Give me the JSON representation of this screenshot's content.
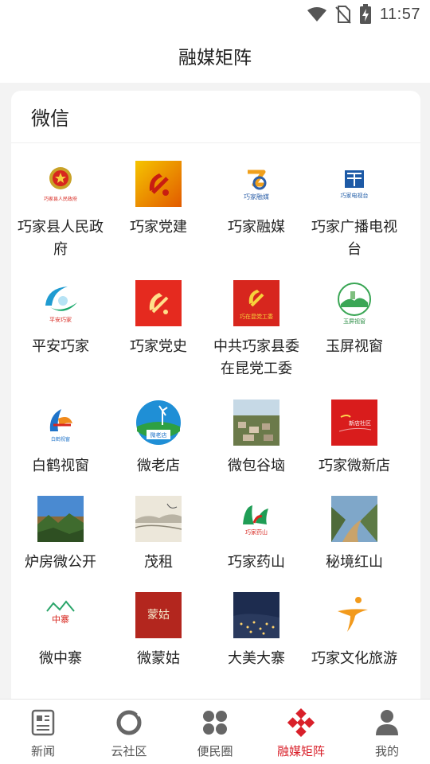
{
  "status_bar": {
    "time": "11:57"
  },
  "header": {
    "title": "融媒矩阵"
  },
  "section": {
    "title": "微信"
  },
  "accounts": [
    {
      "name": "巧家县人民政府",
      "logo_text": "巧家县人民政府",
      "logo": "emblem"
    },
    {
      "name": "巧家党建",
      "logo": "party-emblem"
    },
    {
      "name": "巧家融媒",
      "logo_text": "巧家融媒",
      "logo": "media"
    },
    {
      "name": "巧家广播电视台",
      "logo_text": "巧家电视台",
      "logo": "tv"
    },
    {
      "name": "平安巧家",
      "logo_text": "平安巧家",
      "logo": "swoosh"
    },
    {
      "name": "巧家党史",
      "logo": "party-history"
    },
    {
      "name": "中共巧家县委在昆党工委",
      "logo_text": "巧在昆党工委",
      "logo": "party-red"
    },
    {
      "name": "玉屏视窗",
      "logo_text": "玉屏视窗",
      "logo": "circle-landscape"
    },
    {
      "name": "白鹤视窗",
      "logo_text": "白鹤视窗",
      "logo": "crane"
    },
    {
      "name": "微老店",
      "logo_text": "微老店",
      "logo": "windmill"
    },
    {
      "name": "微包谷垴",
      "logo": "village-photo"
    },
    {
      "name": "巧家微新店",
      "logo_text": "新店社区",
      "logo": "red-flag"
    },
    {
      "name": "炉房微公开",
      "logo": "mountain-photo"
    },
    {
      "name": "茂租",
      "logo": "ink-photo"
    },
    {
      "name": "巧家药山",
      "logo_text": "巧家药山",
      "logo": "green-mark"
    },
    {
      "name": "秘境红山",
      "logo": "valley-photo"
    },
    {
      "name": "微中寨",
      "logo_text": "中寨",
      "logo": "zhongzhai"
    },
    {
      "name": "微蒙姑",
      "logo_text": "蒙姑",
      "logo": "menggu"
    },
    {
      "name": "大美大寨",
      "logo": "night-photo"
    },
    {
      "name": "巧家文化旅游",
      "logo": "runner"
    }
  ],
  "tabs": [
    {
      "label": "新闻",
      "icon": "news-icon"
    },
    {
      "label": "云社区",
      "icon": "cloud-community-icon"
    },
    {
      "label": "便民圈",
      "icon": "services-icon"
    },
    {
      "label": "融媒矩阵",
      "icon": "matrix-icon",
      "active": true
    },
    {
      "label": "我的",
      "icon": "profile-icon"
    }
  ],
  "colors": {
    "accent": "#d9202a",
    "party_red": "#d7261e"
  }
}
